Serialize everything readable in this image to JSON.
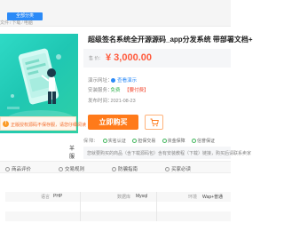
{
  "header": {
    "all_categories": "全部分类",
    "breadcrumb": [
      "文件",
      "下载",
      "电脑"
    ]
  },
  "gallery": {
    "year_label": "羊服"
  },
  "notice": {
    "icon": "!",
    "text": "正版授权源码不保存服，请您仔细阅读"
  },
  "product": {
    "title": "超级签名系统全开源源码_app分发系统 带部署文档+",
    "price_label": "售 价：",
    "price": "¥ 3,000.00",
    "demo_label": "演示网址：",
    "demo_value": "查看演示",
    "install_label": "安装服务：",
    "install_free": "免费",
    "install_pay": "【要付费】",
    "date_label": "发布时间：",
    "date_value": "2021-08-23",
    "buy_label": "立即购买"
  },
  "guarantees": {
    "label": "保 障：",
    "items": [
      "实名认证",
      "担保交易",
      "资金保障",
      "信誉保证"
    ]
  },
  "warning": {
    "text": "您就要购买的商品（含下载源码包）含有安装教程（下载）链接，购买后请联系卖家"
  },
  "tabs": [
    {
      "label": "商品评价",
      "icon": "star-icon"
    },
    {
      "label": "交易规则",
      "icon": "rule-icon"
    },
    {
      "label": "防骗指南",
      "icon": "shield-icon"
    },
    {
      "label": "买家必读",
      "icon": "book-icon"
    }
  ],
  "specs": {
    "row1": {
      "k1": "语言",
      "v1": "PHP",
      "k2": "数据库",
      "v2": "Mysql",
      "k3": "环境",
      "v3": "Wap+普通"
    },
    "row2": {
      "k1": "",
      "v1": "",
      "k2": "",
      "v2": "",
      "k3": "",
      "v3": ""
    },
    "row3": {
      "k1": "",
      "v1": "",
      "k2": "",
      "v2": "",
      "k3": "",
      "v3": ""
    }
  },
  "colors": {
    "accent_orange": "#ff7a1a",
    "price_red": "#ff5a3c",
    "link_blue": "#2b8af7",
    "hero_teal": "#1fc7b3"
  }
}
